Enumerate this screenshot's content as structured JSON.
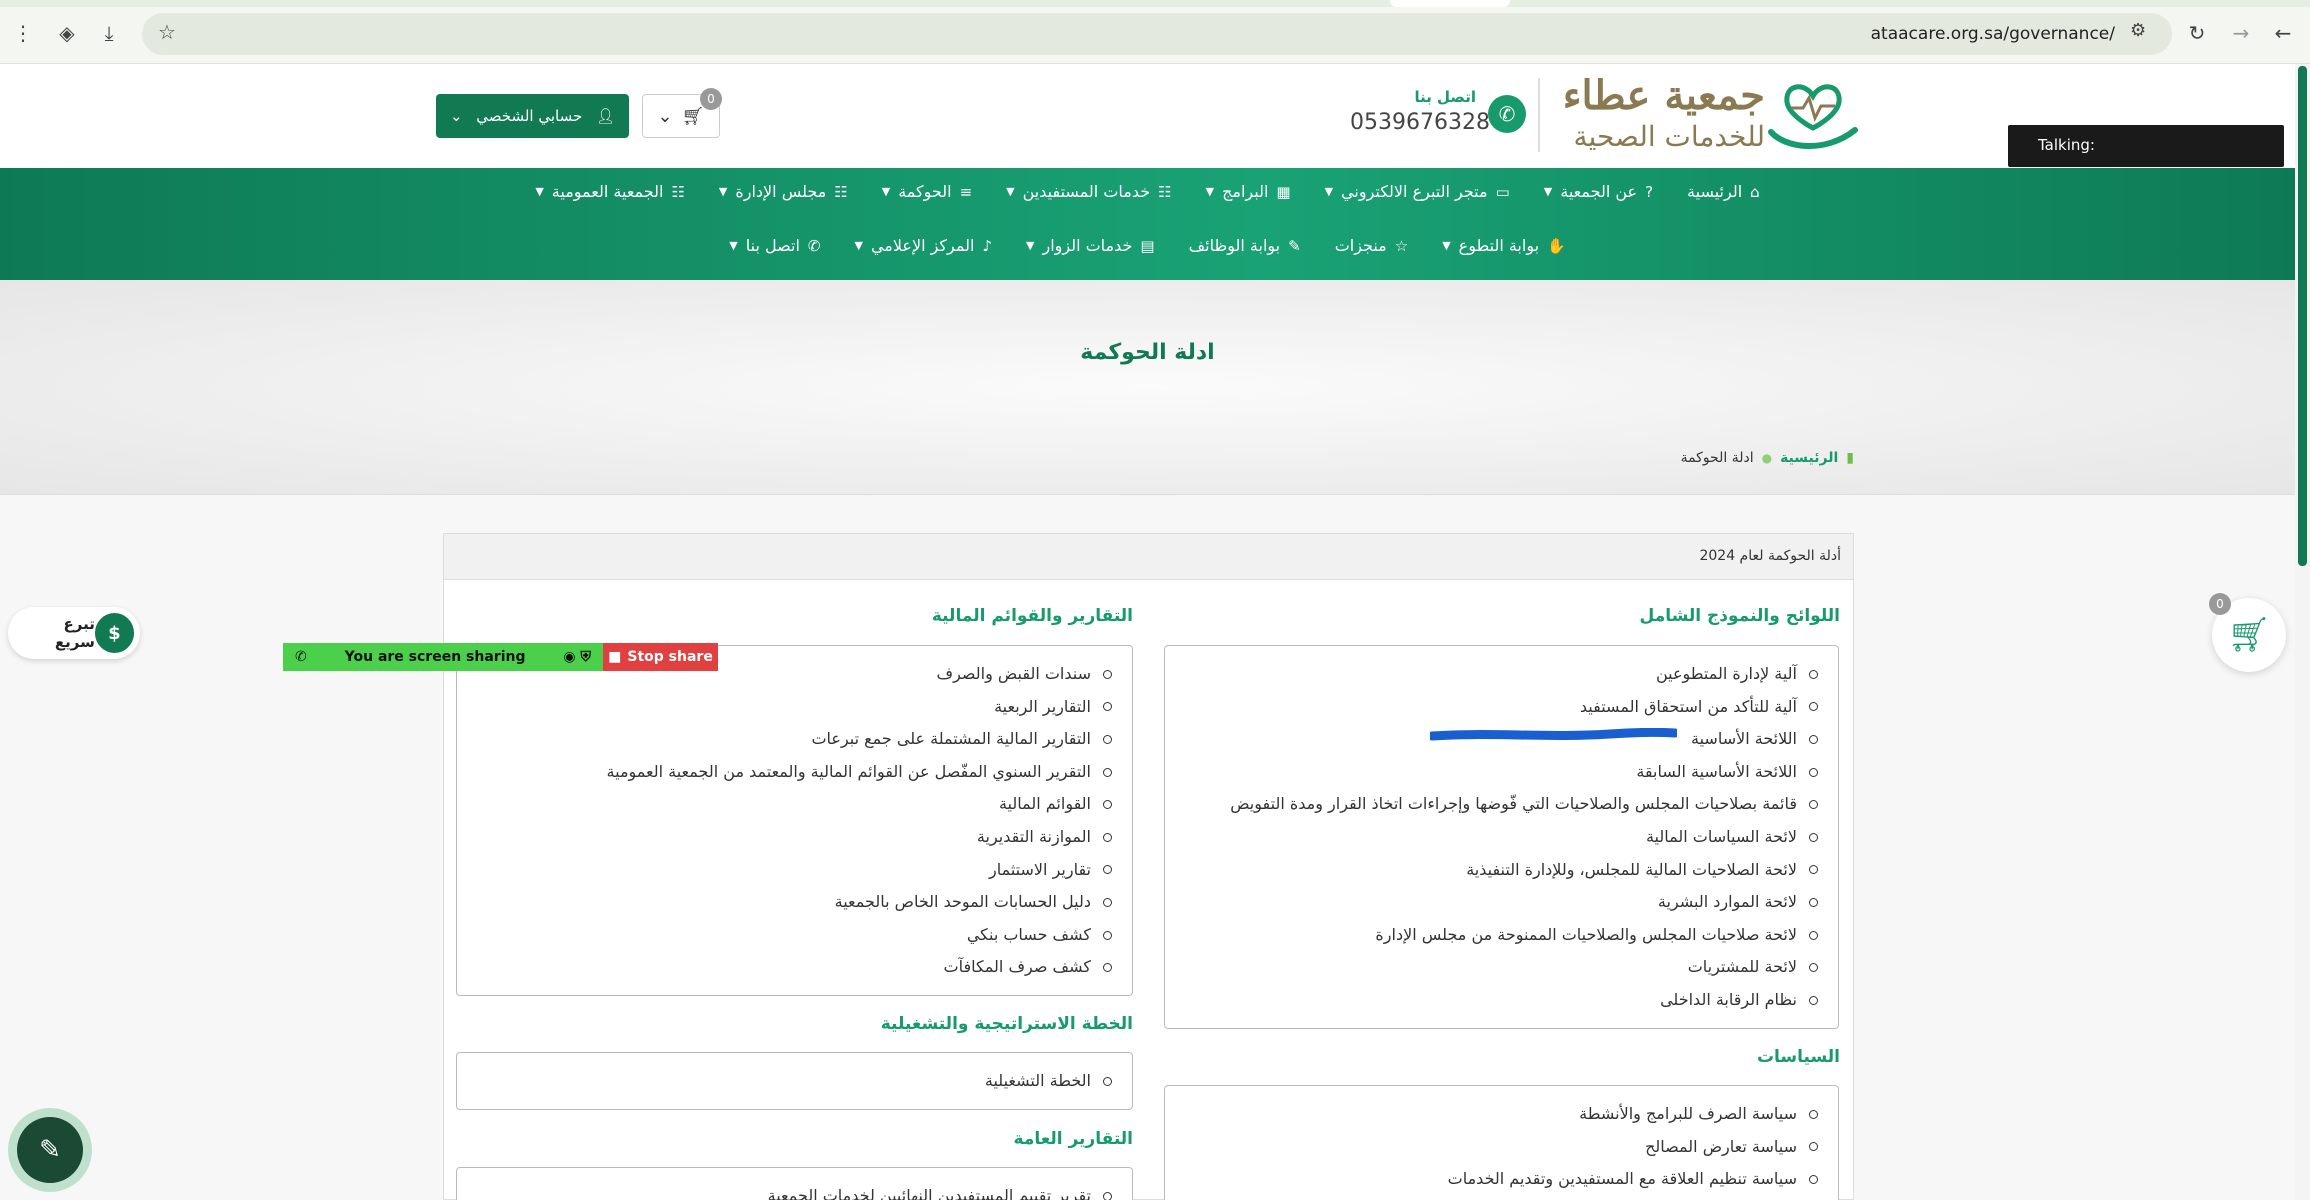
{
  "browser": {
    "url": "ataacare.org.sa/governance/"
  },
  "header": {
    "logo_line1": "جمعية عطاء",
    "logo_line2": "للخدمات الصحية",
    "contact_label": "اتصل بنا",
    "phone": "0539676328",
    "cart_count": "0",
    "account_label": "حسابي الشخصي",
    "talking_label": "Talking:"
  },
  "nav": {
    "row1": [
      {
        "label": "الرئيسية",
        "icon": "home-icon",
        "glyph": "⌂",
        "chevron": false
      },
      {
        "label": "عن الجمعية",
        "icon": "question-icon",
        "glyph": "?",
        "chevron": true
      },
      {
        "label": "متجر التبرع الالكتروني",
        "icon": "card-icon",
        "glyph": "▭",
        "chevron": true
      },
      {
        "label": "البرامج",
        "icon": "calendar-icon",
        "glyph": "▦",
        "chevron": true
      },
      {
        "label": "خدمات المستفيدين",
        "icon": "users-icon",
        "glyph": "☷",
        "chevron": true
      },
      {
        "label": "الحوكمة",
        "icon": "list-icon",
        "glyph": "≡",
        "chevron": true
      },
      {
        "label": "مجلس الإدارة",
        "icon": "group-icon",
        "glyph": "☷",
        "chevron": true
      },
      {
        "label": "الجمعية العمومية",
        "icon": "group-icon",
        "glyph": "☷",
        "chevron": true
      }
    ],
    "row2": [
      {
        "label": "بوابة التطوع",
        "icon": "person-icon",
        "glyph": "✋",
        "chevron": true
      },
      {
        "label": "منجزات",
        "icon": "star-icon",
        "glyph": "☆",
        "chevron": false
      },
      {
        "label": "بوابة الوظائف",
        "icon": "edit-icon",
        "glyph": "✎",
        "chevron": false
      },
      {
        "label": "خدمات الزوار",
        "icon": "server-icon",
        "glyph": "▤",
        "chevron": true
      },
      {
        "label": "المركز الإعلامي",
        "icon": "microphone-icon",
        "glyph": "♪",
        "chevron": true
      },
      {
        "label": "اتصل بنا",
        "icon": "phone-icon",
        "glyph": "✆",
        "chevron": true
      }
    ]
  },
  "hero": {
    "title": "ادلة الحوكمة",
    "breadcrumb_home": "الرئيسية",
    "breadcrumb_current": "ادلة الحوكمة"
  },
  "panel": {
    "heading": "أدلة الحوكمة لعام 2024",
    "regulations": {
      "title": "اللوائح والنموذج الشامل",
      "items": [
        "آلية لإدارة المتطوعين",
        "آلية للتأكد من استحقاق المستفيد",
        "اللائحة الأساسية",
        "اللائحة الأساسية السابقة",
        "قائمة بصلاحيات المجلس والصلاحيات التي فّوضها وإجراءات اتخاذ القرار ومدة التفويض",
        "لائحة السياسات المالية",
        "لائحة الصلاحيات المالية للمجلس، وللإدارة التنفيذية",
        "لائحة الموارد البشرية",
        "لائحة صلاحيات المجلس والصلاحيات الممنوحة من مجلس الإدارة",
        "لائحة للمشتريات",
        "نظام الرقابة الداخلى"
      ]
    },
    "policies": {
      "title": "السياسات",
      "items": [
        "سياسة الصرف للبرامج والأنشطة",
        "سياسة تعارض المصالح",
        "سياسة تنظيم العلاقة مع المستفيدين وتقديم الخدمات"
      ]
    },
    "financial": {
      "title": "التقارير والقوائم المالية",
      "items": [
        "سندات القبض والصرف",
        "التقارير الربعية",
        "التقارير المالية المشتملة على جمع تبرعات",
        "التقرير السنوي المفّصل عن القوائم المالية والمعتمد من الجمعية العمومية",
        "القوائم المالية",
        "الموازنة التقديرية",
        "تقارير الاستثمار",
        "دليل الحسابات الموحد الخاص بالجمعية",
        "كشف حساب بنكي",
        "كشف صرف المكافآت"
      ]
    },
    "strategic": {
      "title": "الخطة الاستراتيجية والتشغيلية",
      "items": [
        "الخطة التشغيلية"
      ]
    },
    "general_reports": {
      "title": "التقارير العامة",
      "items": [
        "تقرير تقييم المستفيدين النهائيين لخدمات الجمعية"
      ]
    }
  },
  "overlays": {
    "sharing_text": "You are screen sharing",
    "stop_share": "Stop share",
    "quick_donate": "تبرع سريع",
    "float_cart_count": "0"
  },
  "colors": {
    "brand_green": "#117a52",
    "accent_green": "#179a6c",
    "logo_gold": "#8a7a52"
  }
}
